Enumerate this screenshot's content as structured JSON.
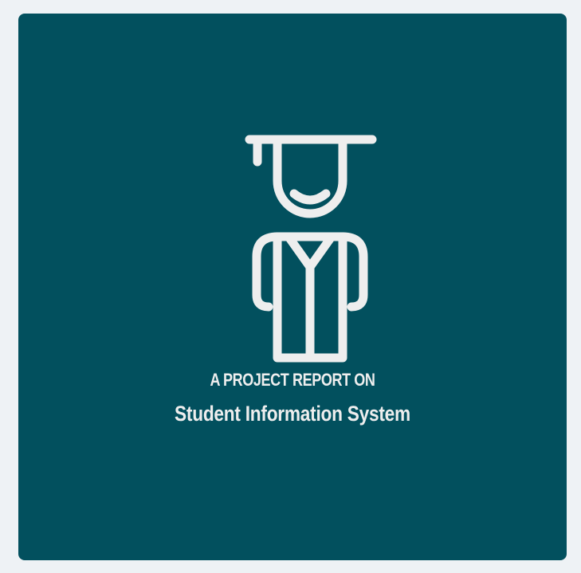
{
  "cover": {
    "icon": "graduate-icon",
    "background_color": "#02505e",
    "foreground_color": "#eeeeee",
    "kicker": "A PROJECT REPORT ON",
    "title": "Student Information System"
  }
}
